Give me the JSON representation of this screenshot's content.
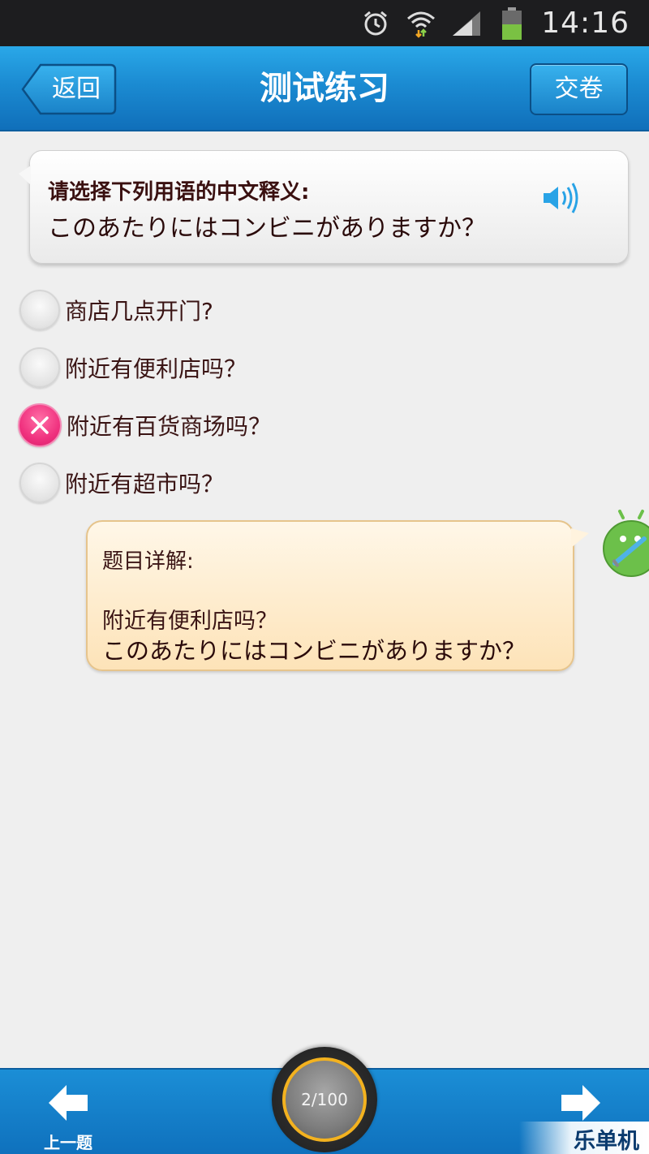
{
  "status_bar": {
    "time": "14:16",
    "icons": [
      "alarm-icon",
      "wifi-icon",
      "signal-icon",
      "battery-icon"
    ]
  },
  "header": {
    "back_label": "返回",
    "title": "测试练习",
    "submit_label": "交卷"
  },
  "question": {
    "prompt": "请选择下列用语的中文释义:",
    "text": "このあたりにはコンビニがありますか？",
    "audio_icon": "speaker-icon"
  },
  "options": [
    {
      "label": "商店几点开门?",
      "state": "unselected"
    },
    {
      "label": "附近有便利店吗？",
      "state": "unselected"
    },
    {
      "label": "附近有百货商场吗？",
      "state": "wrong"
    },
    {
      "label": "附近有超市吗？",
      "state": "unselected"
    }
  ],
  "explanation": {
    "title": "题目详解:",
    "answer": "附近有便利店吗？",
    "source": "このあたりにはコンビニがありますか？"
  },
  "footer": {
    "prev_label": "上一题",
    "progress": "2/100",
    "watermark": "乐单机"
  },
  "colors": {
    "accent_blue": "#1b8bd2",
    "wrong_pink": "#f0327f",
    "progress_ring": "#f3b21f",
    "explain_bg": "#fde3b8"
  }
}
